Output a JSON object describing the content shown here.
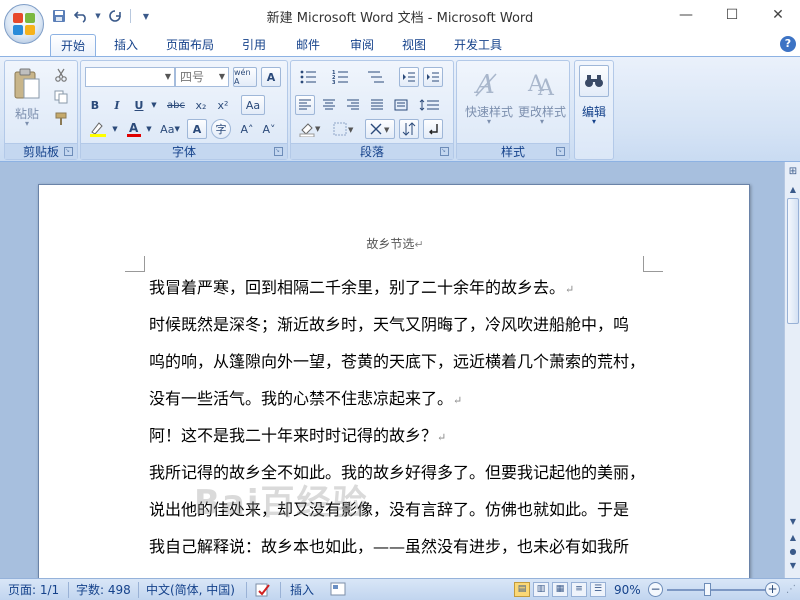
{
  "window": {
    "title": "新建 Microsoft Word 文档 - Microsoft Word",
    "minimize": "—",
    "maximize": "☐",
    "close": "✕"
  },
  "tabs": [
    "开始",
    "插入",
    "页面布局",
    "引用",
    "邮件",
    "审阅",
    "视图",
    "开发工具"
  ],
  "active_tab": "开始",
  "help": "?",
  "ribbon": {
    "clipboard": {
      "label": "剪贴板",
      "paste": "粘贴"
    },
    "font": {
      "label": "字体",
      "font_name": "",
      "font_size": "四号",
      "bold": "B",
      "italic": "I",
      "underline": "U",
      "strike": "abc",
      "subscript": "x₂",
      "superscript": "x²",
      "clear": "Aa",
      "big_a": "A",
      "shrink": "A˅",
      "grow": "A˄",
      "phonetic": "wén A",
      "char_border": "A"
    },
    "paragraph": {
      "label": "段落"
    },
    "styles": {
      "label": "样式",
      "quick": "快速样式",
      "change": "更改样式"
    },
    "editing": {
      "label": "编辑"
    }
  },
  "document": {
    "header": "故乡节选",
    "lines": [
      "我冒着严寒，回到相隔二千余里，别了二十余年的故乡去。",
      "时候既然是深冬；渐近故乡时，天气又阴晦了，冷风吹进船舱中，呜",
      "呜的响，从篷隙向外一望，苍黄的天底下，远近横着几个萧索的荒村，",
      "没有一些活气。我的心禁不住悲凉起来了。",
      "阿！这不是我二十年来时时记得的故乡？",
      "我所记得的故乡全不如此。我的故乡好得多了。但要我记起他的美丽，",
      "说出他的佳处来，却又没有影像，没有言辞了。仿佛也就如此。于是",
      "我自己解释说：故乡本也如此，——虽然没有进步，也未必有如我所"
    ],
    "paragraph_mark": "↵",
    "watermark": "Bai百经验"
  },
  "statusbar": {
    "page": "页面: 1/1",
    "words": "字数: 498",
    "language": "中文(简体, 中国)",
    "mode": "插入",
    "zoom": "90%",
    "zoom_minus": "−",
    "zoom_plus": "+"
  },
  "zoom_level": 0.9
}
